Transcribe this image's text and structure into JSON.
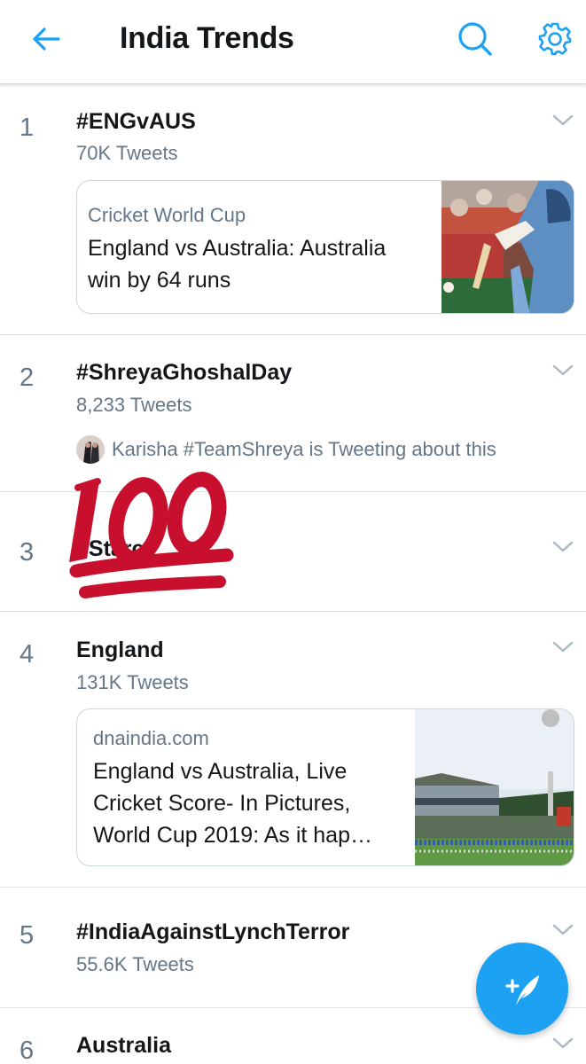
{
  "header": {
    "title": "India Trends",
    "back_icon": "arrow-left-icon",
    "search_icon": "search-icon",
    "settings_icon": "gear-icon",
    "accent": "#1da1f2"
  },
  "trends": [
    {
      "rank": "1",
      "name": "#ENGvAUS",
      "count": "70K Tweets",
      "card": {
        "source": "Cricket World Cup",
        "title_line1": "England vs Australia: Australia",
        "title_line2": "win by 64 runs"
      }
    },
    {
      "rank": "2",
      "name": "#ShreyaGhoshalDay",
      "count": "8,233 Tweets",
      "social": "Karisha #TeamShreya is Tweeting about this"
    },
    {
      "rank": "3",
      "name": "#Starc"
    },
    {
      "rank": "4",
      "name": "England",
      "count": "131K Tweets",
      "card": {
        "source": "dnaindia.com",
        "title_line1": "England vs Australia, Live",
        "title_line2": "Cricket Score- In Pictures,",
        "title_line3": "World Cup 2019: As it hap…"
      }
    },
    {
      "rank": "5",
      "name": "#IndiaAgainstLynchTerror",
      "count": "55.6K Tweets"
    },
    {
      "rank": "6",
      "name": "Australia"
    }
  ],
  "overlay": {
    "emoji": "hundred-points-emoji",
    "color": "#c8102e"
  },
  "fab": {
    "icon": "compose-tweet-icon"
  }
}
